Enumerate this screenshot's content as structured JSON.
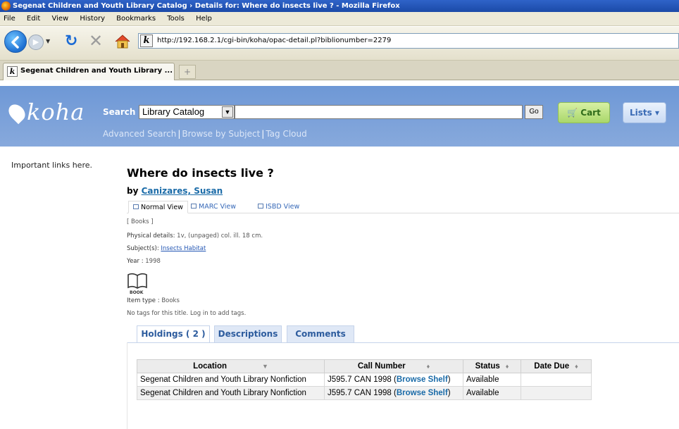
{
  "window": {
    "title": "Segenat Children and Youth Library Catalog › Details for: Where do insects live ? - Mozilla Firefox"
  },
  "menu": [
    "File",
    "Edit",
    "View",
    "History",
    "Bookmarks",
    "Tools",
    "Help"
  ],
  "browser": {
    "url": "http://192.168.2.1/cgi-bin/koha/opac-detail.pl?biblionumber=2279",
    "tab_label": "Segenat Children and Youth Library ...",
    "new_tab": "+"
  },
  "header": {
    "logo": "koha",
    "search_label": "Search",
    "catalog_option": "Library Catalog",
    "search_value": "",
    "go_label": "Go",
    "cart_label": "Cart",
    "lists_label": "Lists ▾",
    "links": [
      "Advanced Search",
      "Browse by Subject",
      "Tag Cloud"
    ]
  },
  "sidebar": {
    "text": "Important links here."
  },
  "record": {
    "title": "Where do insects live ?",
    "by": "by",
    "author": "Canizares, Susan",
    "view_tabs": [
      "Normal View",
      "MARC View",
      "ISBD View"
    ],
    "type_bracket": "[ Books ]",
    "physical_label": "Physical details:",
    "physical_value": "1v, (unpaged) col. ill. 18 cm.",
    "subject_label": "Subject(s):",
    "subject_value": "Insects Habitat",
    "year_label": "Year :",
    "year_value": "1998",
    "book_icon_caption": "BOOK",
    "item_type_label": "Item type :",
    "item_type_value": "Books",
    "tags_text": "No tags for this title. Log in to add tags."
  },
  "content_tabs": [
    "Holdings ( 2 )",
    "Descriptions",
    "Comments"
  ],
  "holdings": {
    "columns": [
      "Location",
      "Call Number",
      "Status",
      "Date Due"
    ],
    "rows": [
      {
        "location": "Segenat Children and Youth Library Nonfiction",
        "call_number": "J595.7 CAN 1998",
        "browse": "Browse Shelf",
        "status": "Available",
        "date_due": ""
      },
      {
        "location": "Segenat Children and Youth Library Nonfiction",
        "call_number": "J595.7 CAN 1998",
        "browse": "Browse Shelf",
        "status": "Available",
        "date_due": ""
      }
    ]
  },
  "colors": {
    "header_blue": "#7aa0d8",
    "link_blue": "#1a6ba8",
    "cart_green": "#a9d76b"
  }
}
